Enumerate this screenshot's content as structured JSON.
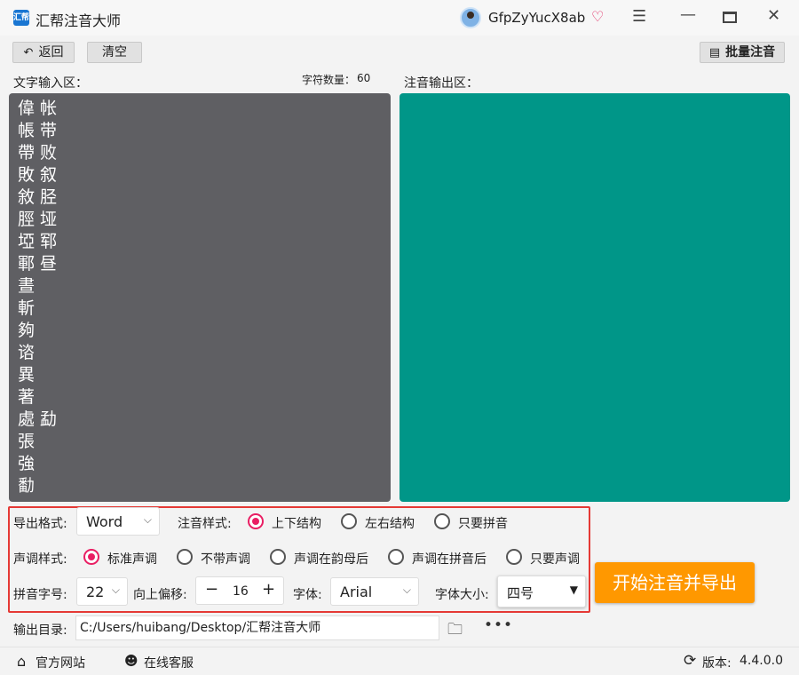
{
  "app": {
    "title": "汇帮注音大师",
    "logo_text": "汇帮"
  },
  "user": {
    "name": "GfpZyYucX8ab"
  },
  "toolbar": {
    "back_label": "返回",
    "clear_label": "清空",
    "batch_label": "批量注音"
  },
  "input_panel": {
    "label": "文字输入区：",
    "count_label": "字符数量：",
    "count_value": "60",
    "text": "偉 帐\n帳 带\n帶 败\n敗 叙\n敘 胫\n脛 垭\n埡 郓\n鄆 昼\n晝\n斬\n夠\n谘\n異\n著\n處 勐\n張\n強\n勫"
  },
  "output_panel": {
    "label": "注音输出区："
  },
  "settings": {
    "export_format_label": "导出格式:",
    "export_format_value": "Word",
    "phonetic_style_label": "注音样式:",
    "phonetic_options": [
      "上下结构",
      "左右结构",
      "只要拼音"
    ],
    "phonetic_selected": 0,
    "tone_style_label": "声调样式:",
    "tone_options": [
      "标准声调",
      "不带声调",
      "声调在韵母后",
      "声调在拼音后",
      "只要声调"
    ],
    "tone_selected": 0,
    "pinyin_size_label": "拼音字号:",
    "pinyin_size_value": "22",
    "offset_label": "向上偏移:",
    "offset_value": "16",
    "font_label": "字体:",
    "font_value": "Arial",
    "font_size_label": "字体大小:",
    "font_size_value": "四号"
  },
  "start_button": "开始注音并导出",
  "output_dir": {
    "label": "输出目录:",
    "value": "C:/Users/huibang/Desktop/汇帮注音大师"
  },
  "footer": {
    "home_label": "官方网站",
    "service_label": "在线客服",
    "version_label": "版本:",
    "version_value": "4.4.0.0"
  },
  "colors": {
    "input_bg": "#5f5f63",
    "output_bg": "#009688",
    "accent": "#e91e63",
    "start_button": "#ff9800",
    "highlight_border": "#e53935"
  }
}
